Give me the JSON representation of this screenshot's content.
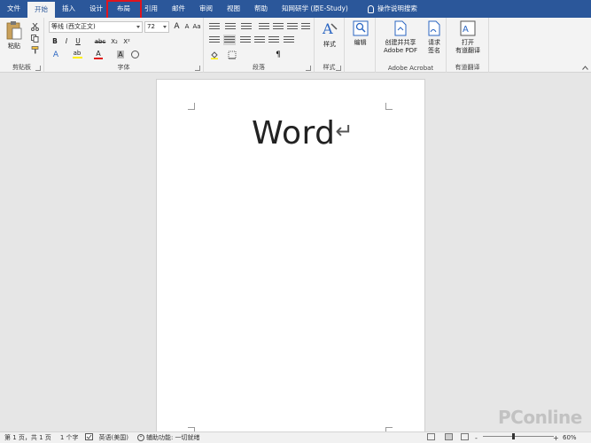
{
  "tabs": [
    "文件",
    "开始",
    "插入",
    "设计",
    "布局",
    "引用",
    "邮件",
    "审阅",
    "视图",
    "帮助",
    "知网研学 (原E-Study)"
  ],
  "active_tab_index": 1,
  "tell_me": "操作说明搜索",
  "highlighted_tab": "布局",
  "clipboard": {
    "paste_label": "粘贴",
    "group_label": "剪贴板"
  },
  "font": {
    "font_name": "等线 (西文正文)",
    "font_size": "72",
    "bold": "B",
    "italic": "I",
    "underline": "U",
    "strike": "abc",
    "subscript": "X₂",
    "superscript": "X²",
    "grow": "A",
    "shrink": "A",
    "case": "Aa",
    "font_color": "A",
    "highlight": "ab",
    "clear_format": "A",
    "group_label": "字体"
  },
  "paragraph": {
    "group_label": "段落"
  },
  "styles": {
    "label": "样式",
    "group_label": "样式"
  },
  "editing": {
    "label": "编辑"
  },
  "acrobat": {
    "create_pdf_l1": "创建并共享",
    "create_pdf_l2": "Adobe PDF",
    "sign_l1": "请求",
    "sign_l2": "签名",
    "group_label": "Adobe Acrobat"
  },
  "translate": {
    "label_l1": "打开",
    "label_l2": "有道翻译",
    "group_label": "有道翻译"
  },
  "document": {
    "text": "Word",
    "para_mark": "↵"
  },
  "status": {
    "page": "第 1 页，共 1 页",
    "words": "1 个字",
    "language": "英语(美国)",
    "accessibility": "辅助功能: 一切就绪",
    "zoom": "60%",
    "zoom_minus": "-",
    "zoom_plus": "+"
  },
  "watermark": "PConline",
  "colors": {
    "ribbon_blue": "#2b579a",
    "highlight_red": "#e0141e",
    "font_red": "#e11b1b",
    "highlight_yellow": "#ffef00"
  }
}
